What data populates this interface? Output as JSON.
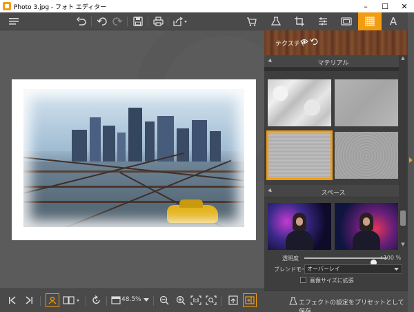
{
  "window": {
    "title": "Photo 3.jpg - フォト エディター",
    "controls": [
      "minimize",
      "maximize",
      "close"
    ]
  },
  "toolbar": {
    "icons": [
      "menu-icon",
      "undo-all-icon",
      "undo-icon",
      "redo-icon",
      "save-icon",
      "print-icon",
      "share-icon",
      "cart-icon"
    ]
  },
  "right_tabs": {
    "items": [
      "flask-icon",
      "crop-icon",
      "sliders-icon",
      "frame-icon",
      "texture-icon",
      "text-icon"
    ],
    "active": "texture-icon"
  },
  "texture_panel": {
    "header_label": "テクスチャ",
    "section_material": "マテリアル",
    "section_space": "スペース",
    "opacity_label": "透明度",
    "opacity_value": "+100 %",
    "opacity_level": 1.0,
    "blend_label": "ブレンドモード",
    "blend_value": "オーバーレイ",
    "scale_label": "画像サイズに拡張",
    "preset_button": "エフェクトの設定をプリセットとして保存"
  },
  "bottom": {
    "zoom": "48.5%"
  },
  "colors": {
    "accent": "#f39c12",
    "panel_bg": "#3e3e3e",
    "canvas_bg": "#5b5b5b"
  }
}
